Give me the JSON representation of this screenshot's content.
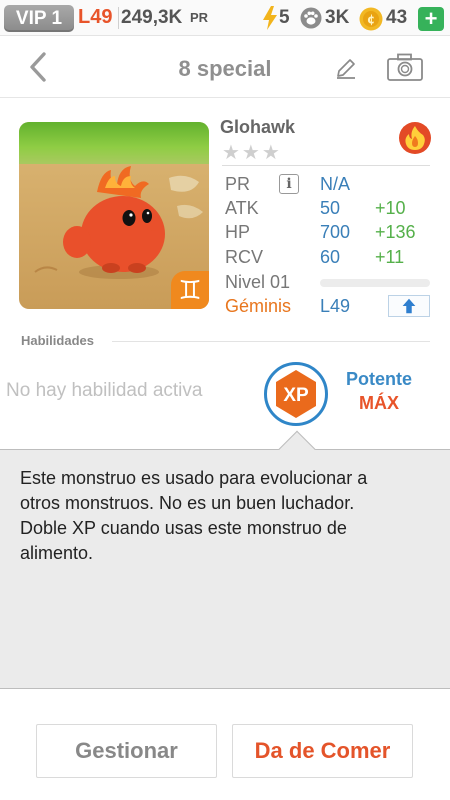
{
  "status_bar": {
    "vip": "VIP 1",
    "level": "L49",
    "pr_value": "249,3K",
    "pr_unit": "PR",
    "energy": "5",
    "paws": "3K",
    "coins": "43",
    "add_label": "+"
  },
  "header": {
    "title": "8 special",
    "back_icon": "chevron-left-icon",
    "edit_icon": "pencil-icon",
    "camera_icon": "camera-icon"
  },
  "monster": {
    "name": "Glohawk",
    "rarity_stars": "★★★",
    "element_icon": "fire-icon",
    "sign_symbol": "♊",
    "stats": {
      "pr": {
        "label": "PR",
        "value": "N/A"
      },
      "atk": {
        "label": "ATK",
        "value": "50",
        "bonus": "+10"
      },
      "hp": {
        "label": "HP",
        "value": "700",
        "bonus": "+136"
      },
      "rcv": {
        "label": "RCV",
        "value": "60",
        "bonus": "+11"
      },
      "level": {
        "label": "Nivel 01",
        "progress": 0
      },
      "sign": {
        "label": "Géminis",
        "value": "L49"
      }
    }
  },
  "abilities": {
    "title": "Habilidades",
    "none_text": "No hay habilidad activa",
    "xp_label": "XP",
    "potency_label": "Potente",
    "potency_value": "MÁX"
  },
  "description": {
    "lines": [
      "Este monstruo es usado para evolucionar a",
      "otros monstruos. No es un buen luchador.",
      "Doble XP cuando usas este monstruo de",
      "alimento."
    ]
  },
  "buttons": {
    "manage": "Gestionar",
    "feed": "Da de Comer"
  },
  "colors": {
    "accent_orange": "#e8542a",
    "stat_blue": "#3a7fb8",
    "bonus_green": "#55b04a",
    "plus_green": "#36b25a"
  }
}
